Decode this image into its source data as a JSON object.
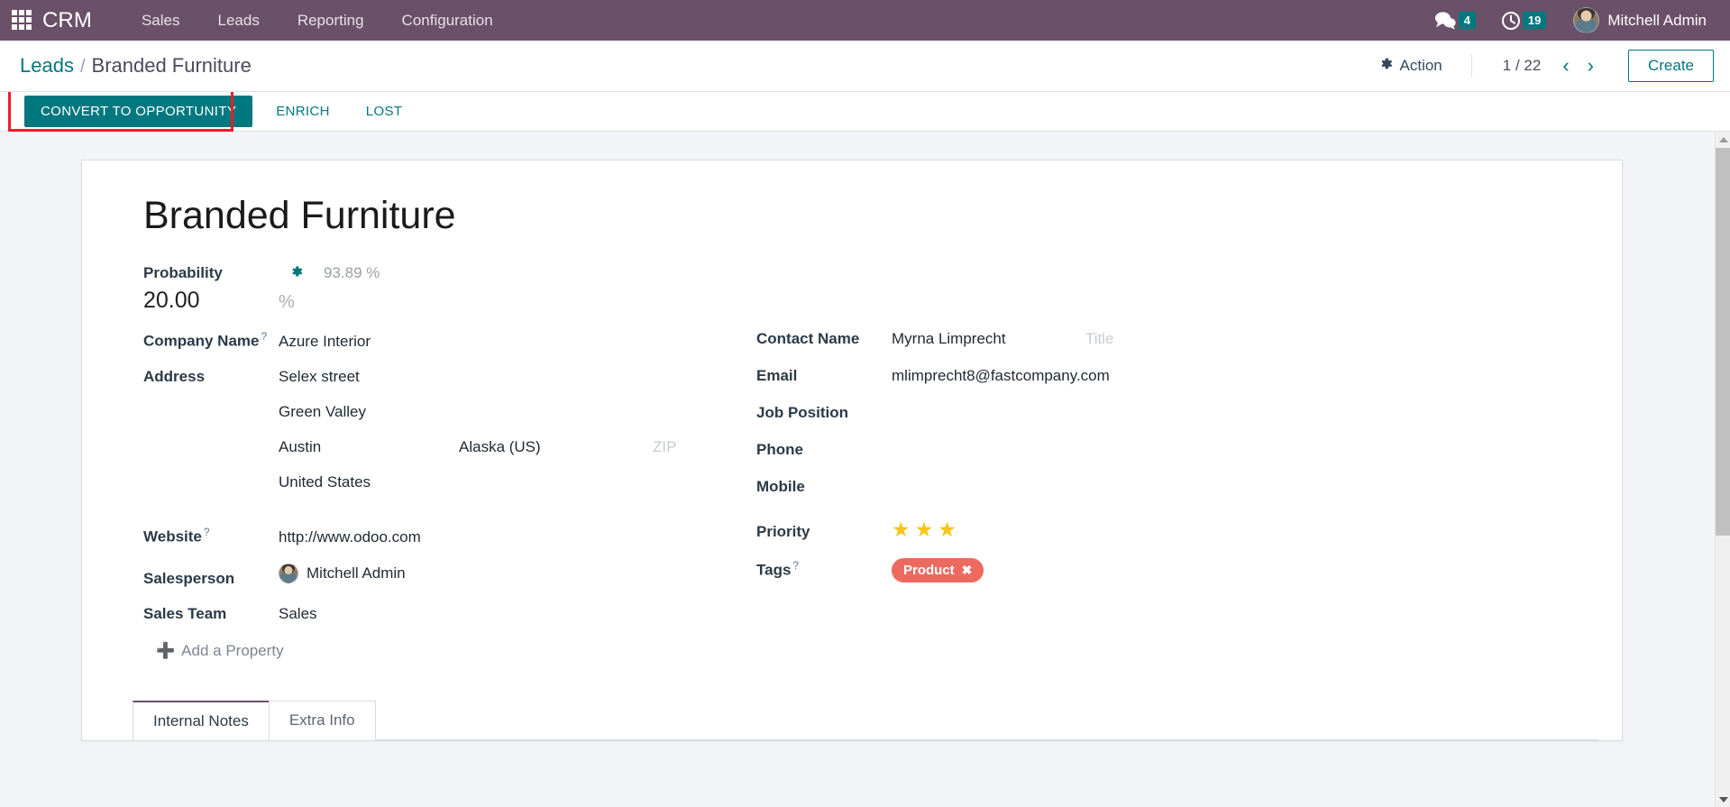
{
  "navbar": {
    "apps_icon": "apps-grid-icon",
    "brand": "CRM",
    "menu": [
      {
        "label": "Sales"
      },
      {
        "label": "Leads"
      },
      {
        "label": "Reporting"
      },
      {
        "label": "Configuration"
      }
    ],
    "messages_icon": "chat-bubble-icon",
    "messages_count": "4",
    "activities_icon": "clock-icon",
    "activities_count": "19",
    "user_name": "Mitchell Admin",
    "avatar_icon": "user-avatar",
    "bg_color": "#6a5068",
    "badge_color": "#00787f"
  },
  "control_panel": {
    "breadcrumb_root": "Leads",
    "breadcrumb_separator": "/",
    "breadcrumb_current": "Branded Furniture",
    "action_icon": "gear-icon",
    "action_label": "Action",
    "pager_text": "1 / 22",
    "prev_icon": "chevron-left-icon",
    "prev_glyph": "‹",
    "next_icon": "chevron-right-icon",
    "next_glyph": "›",
    "create_label": "Create",
    "accent_color": "#00787f"
  },
  "statusbar": {
    "primary_button": "CONVERT TO OPPORTUNITY",
    "secondary_buttons": [
      {
        "label": "ENRICH"
      },
      {
        "label": "LOST"
      }
    ],
    "highlight_color": "#ee1c25"
  },
  "form": {
    "record_title": "Branded Furniture",
    "probability": {
      "label": "Probability",
      "gear_icon": "gear-icon",
      "computed_value": "93.89 %",
      "value": "20.00",
      "unit": "%"
    },
    "left_column": [
      {
        "label": "Company Name",
        "tooltip": "?",
        "value": "Azure Interior"
      }
    ],
    "address": {
      "label": "Address",
      "street": "Selex street",
      "street2": "Green Valley",
      "city": "Austin",
      "state": "Alaska (US)",
      "zip_placeholder": "ZIP",
      "country": "United States"
    },
    "website": {
      "label": "Website",
      "tooltip": "?",
      "value": "http://www.odoo.com"
    },
    "salesperson": {
      "label": "Salesperson",
      "value": "Mitchell Admin",
      "avatar_icon": "user-avatar"
    },
    "sales_team": {
      "label": "Sales Team",
      "value": "Sales"
    },
    "add_property": {
      "icon": "plus-icon",
      "label": "Add a Property"
    },
    "contact_name": {
      "label": "Contact Name",
      "value": "Myrna Limprecht",
      "title_placeholder": "Title"
    },
    "email": {
      "label": "Email",
      "value": "mlimprecht8@fastcompany.com"
    },
    "job_position": {
      "label": "Job Position",
      "value": ""
    },
    "phone": {
      "label": "Phone",
      "value": ""
    },
    "mobile": {
      "label": "Mobile",
      "value": ""
    },
    "priority": {
      "label": "Priority",
      "stars_filled": 3,
      "star_glyph": "★",
      "star_color": "#f5c518"
    },
    "tags": {
      "label": "Tags",
      "tooltip": "?",
      "items": [
        {
          "name": "Product",
          "color": "#ed6a5e",
          "remove_icon": "close-icon",
          "remove_glyph": "✖"
        }
      ]
    }
  },
  "notebook": {
    "tabs": [
      {
        "label": "Internal Notes",
        "active": true
      },
      {
        "label": "Extra Info",
        "active": false
      }
    ],
    "active_border_color": "#6a5068"
  },
  "scrollbar": {
    "up_icon": "scroll-up-arrow-icon",
    "down_icon": "scroll-down-arrow-icon",
    "thumb_icon": "scrollbar-thumb"
  }
}
